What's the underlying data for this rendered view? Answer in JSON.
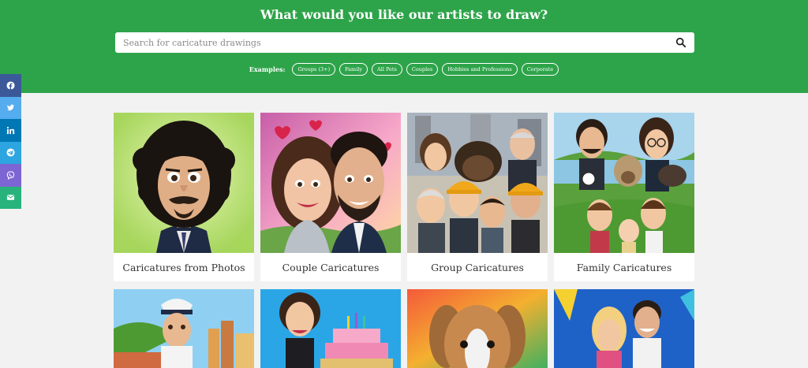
{
  "hero": {
    "title": "What would you like our artists to draw?",
    "search_placeholder": "Search for caricature drawings",
    "examples_label": "Examples:",
    "chips": [
      "Groups (3+)",
      "Family",
      "All Pets",
      "Couples",
      "Hobbies and Professions",
      "Corporate"
    ]
  },
  "social": [
    {
      "icon": "facebook-icon",
      "color": "#3b5998"
    },
    {
      "icon": "twitter-icon",
      "color": "#55acee"
    },
    {
      "icon": "linkedin-icon",
      "color": "#0077b5"
    },
    {
      "icon": "telegram-icon",
      "color": "#2ca5e0"
    },
    {
      "icon": "viber-icon",
      "color": "#7d65d4"
    },
    {
      "icon": "email-icon",
      "color": "#27b37b"
    }
  ],
  "cards": [
    {
      "caption": "Caricatures from Photos"
    },
    {
      "caption": "Couple Caricatures"
    },
    {
      "caption": "Group Caricatures"
    },
    {
      "caption": "Family Caricatures"
    },
    {
      "caption": ""
    },
    {
      "caption": ""
    },
    {
      "caption": ""
    },
    {
      "caption": ""
    }
  ],
  "colors": {
    "brand_green": "#2ea44a"
  }
}
